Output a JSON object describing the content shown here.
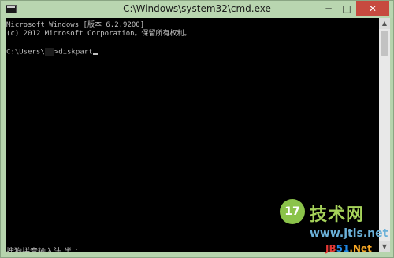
{
  "window": {
    "title": "C:\\Windows\\system32\\cmd.exe",
    "minimize_glyph": "─",
    "maximize_glyph": "□",
    "close_glyph": "✕"
  },
  "console": {
    "line1": "Microsoft Windows [版本 6.2.9200]",
    "line2": "(c) 2012 Microsoft Corporation。保留所有权利。",
    "prompt_prefix": "C:\\Users\\",
    "prompt_suffix": ">diskpart",
    "ime_status": "搜狗拼音输入法 半 ："
  },
  "watermark": {
    "badge": "17",
    "brand": "技术网",
    "url": "www.jtis.net",
    "jb": "JB51.Net"
  },
  "colors": {
    "console_bg": "#000000",
    "console_text": "#c0c0c0",
    "titlebar": "#b9d6b0",
    "close_button": "#c74a3f"
  }
}
